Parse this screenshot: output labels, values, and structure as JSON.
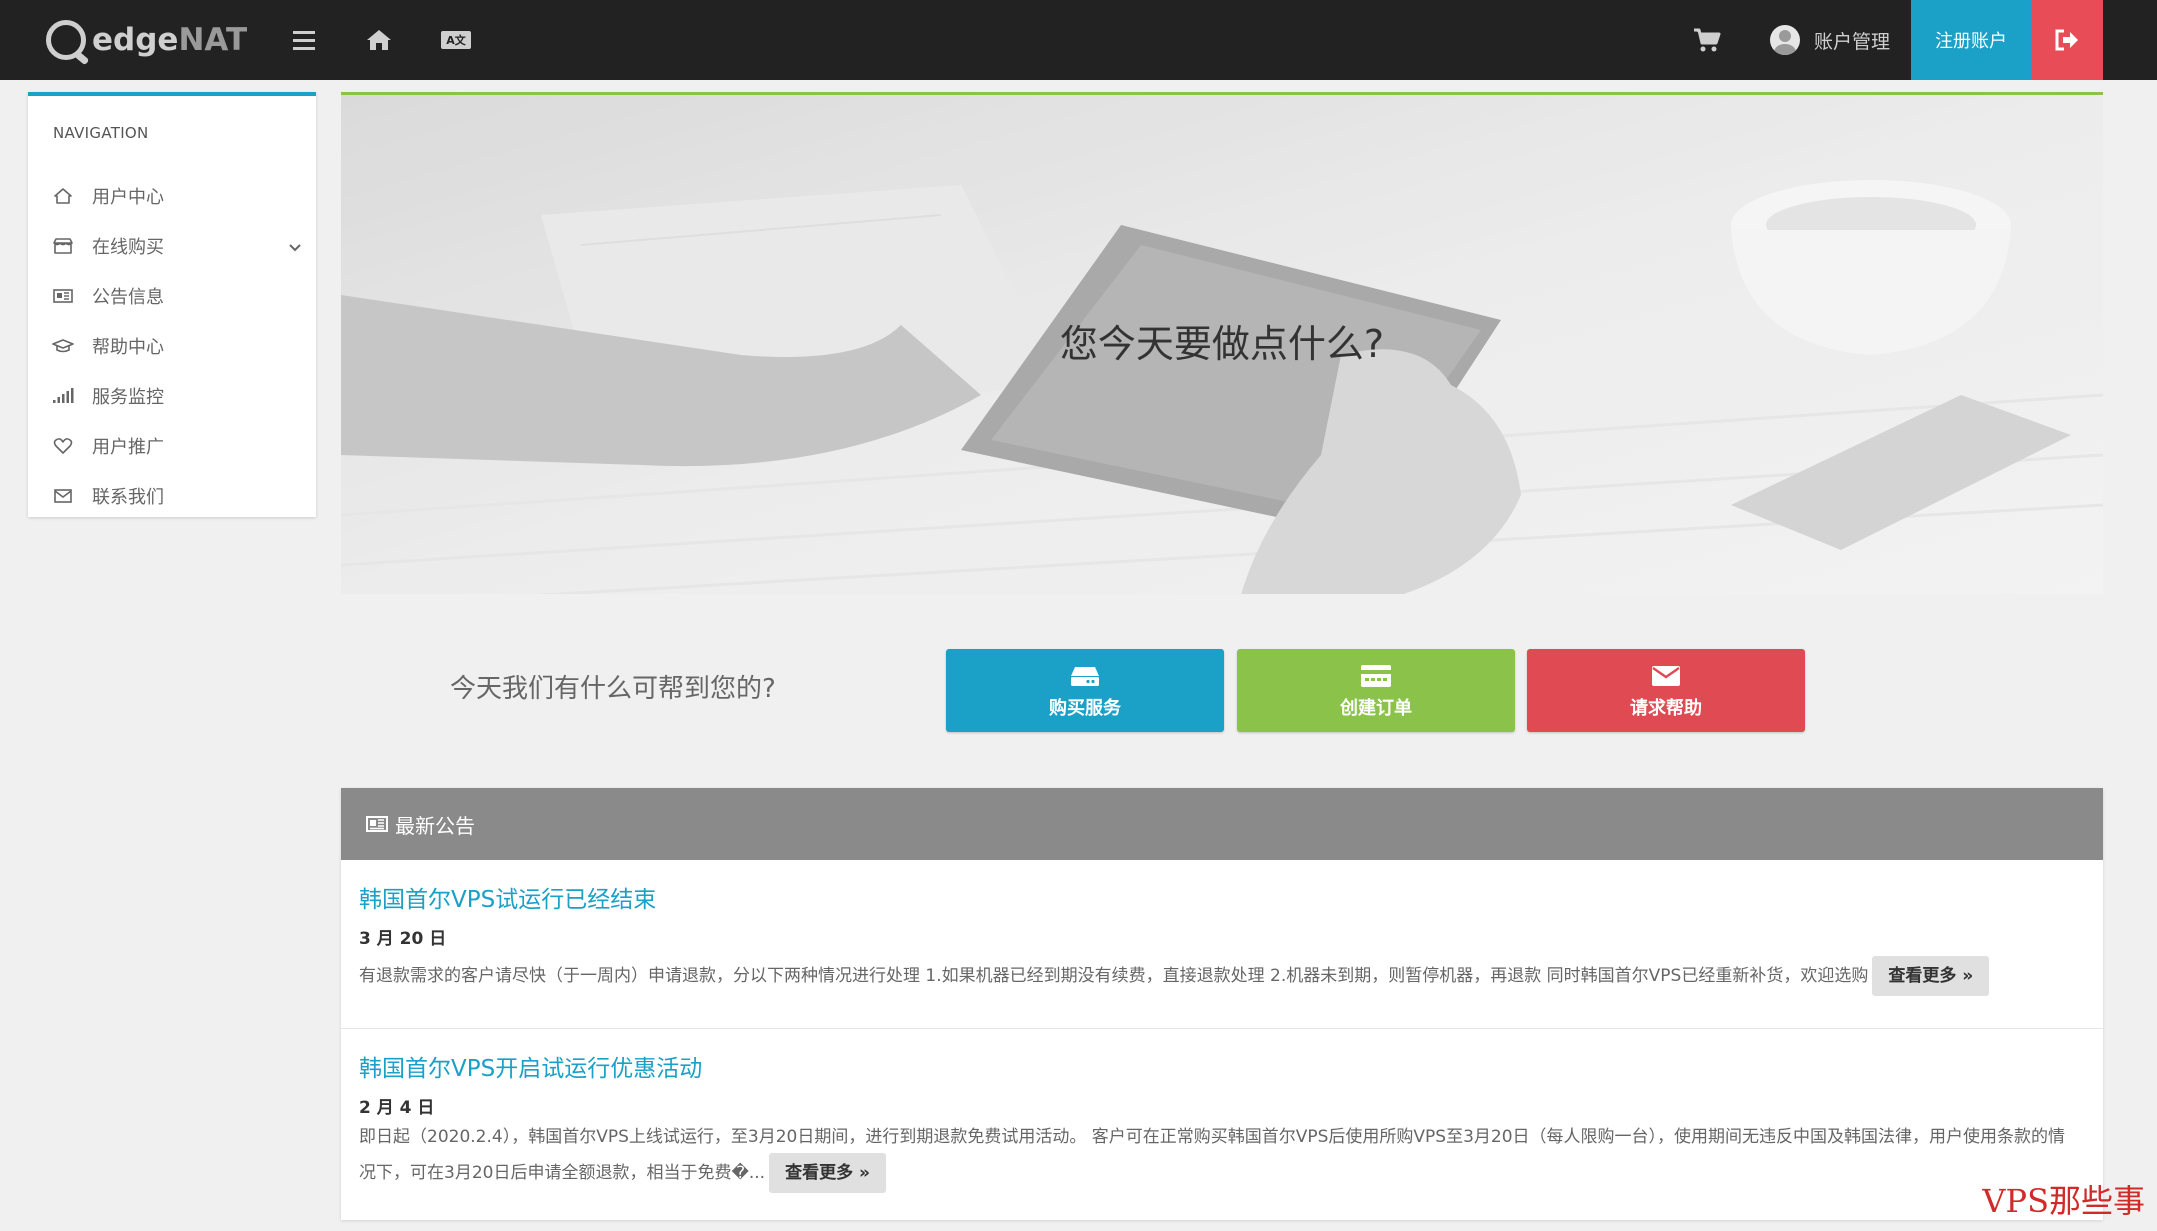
{
  "header": {
    "logo_text_a": "edge",
    "logo_text_b": "NAT",
    "lang_glyph": "A文",
    "account_label": "账户管理",
    "register_label": "注册账户"
  },
  "sidebar": {
    "title": "NAVIGATION",
    "items": [
      {
        "label": "用户中心",
        "icon": "home-icon"
      },
      {
        "label": "在线购买",
        "icon": "storefront-icon"
      },
      {
        "label": "公告信息",
        "icon": "newspaper-icon"
      },
      {
        "label": "帮助中心",
        "icon": "graduation-cap-icon"
      },
      {
        "label": "服务监控",
        "icon": "signal-icon"
      },
      {
        "label": "用户推广",
        "icon": "heart-icon"
      },
      {
        "label": "联系我们",
        "icon": "envelope-icon"
      }
    ]
  },
  "hero": {
    "title": "您今天要做点什么?"
  },
  "help": {
    "prompt": "今天我们有什么可帮到您的?",
    "buttons": {
      "buy": "购买服务",
      "order": "创建订单",
      "help": "请求帮助"
    }
  },
  "announcements": {
    "heading": "最新公告",
    "more_label": "查看更多 »",
    "items": [
      {
        "title": "韩国首尔VPS试运行已经结束",
        "date": "3 月 20 日",
        "body": "有退款需求的客户请尽快（于一周内）申请退款，分以下两种情况进行处理 1.如果机器已经到期没有续费，直接退款处理 2.机器未到期，则暂停机器，再退款 同时韩国首尔VPS已经重新补货，欢迎选购"
      },
      {
        "title": "韩国首尔VPS开启试运行优惠活动",
        "date": "2 月 4 日",
        "body": "即日起（2020.2.4），韩国首尔VPS上线试运行，至3月20日期间，进行到期退款免费试用活动。 客户可在正常购买韩国首尔VPS后使用所购VPS至3月20日（每人限购一台），使用期间无违反中国及韩国法律，用户使用条款的情况下，可在3月20日后申请全额退款，相当于免费�..."
      }
    ]
  },
  "watermark": "VPS那些事",
  "colors": {
    "topbar": "#222222",
    "primary": "#1ba0c7",
    "success": "#8bc34a",
    "danger": "#e04a52",
    "panel_head": "#8a8a8a"
  }
}
